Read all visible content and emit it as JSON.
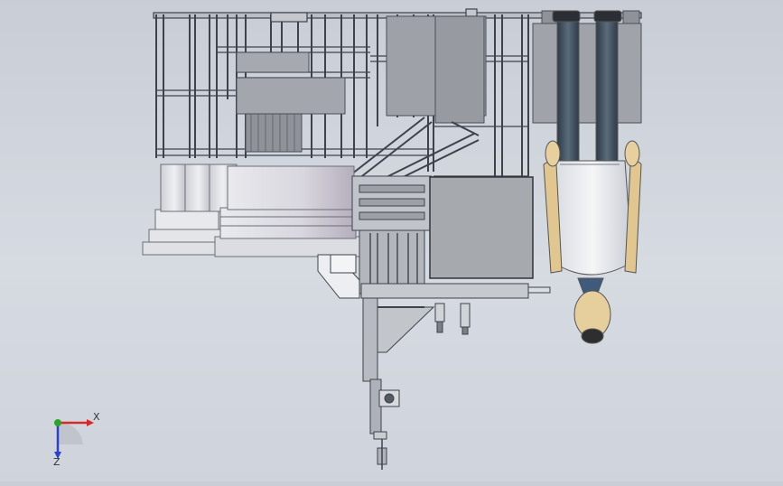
{
  "viewport": {
    "background_top": "#c9ced6",
    "background_bottom": "#d6dae1",
    "frame_stroke": "#4a4f57",
    "panel_fill": "#9ea2a8",
    "drum_fill": "#e3e4e8",
    "figure_suit": "#e9ecef",
    "figure_pants": "#3b4a57",
    "figure_skin": "#e2c690"
  },
  "triad": {
    "x_label": "X",
    "z_label": "Z",
    "x_color": "#d42a2a",
    "y_color": "#2aa52a",
    "z_color": "#2a3fd4"
  }
}
